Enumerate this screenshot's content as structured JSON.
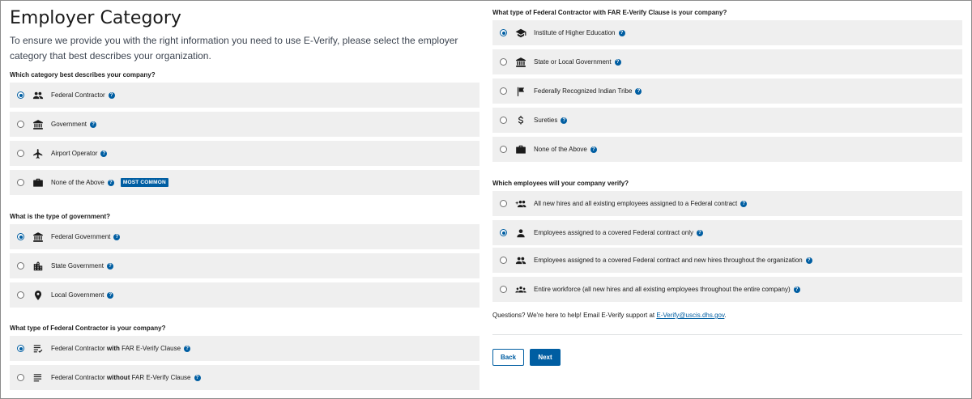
{
  "page": {
    "title": "Employer Category",
    "intro": "To ensure we provide you with the right information you need to use E-Verify, please select the employer category that best describes your organization."
  },
  "q1": {
    "question": "Which category best describes your company?",
    "options": [
      {
        "label": "Federal Contractor",
        "icon": "people-icon",
        "selected": true
      },
      {
        "label": "Government",
        "icon": "bank-icon",
        "selected": false
      },
      {
        "label": "Airport Operator",
        "icon": "airplane-icon",
        "selected": false
      },
      {
        "label": "None of the Above",
        "icon": "briefcase-icon",
        "selected": false,
        "badge": "MOST COMMON"
      }
    ]
  },
  "q2": {
    "question": "What is the type of government?",
    "options": [
      {
        "label": "Federal Government",
        "icon": "bank-icon",
        "selected": true
      },
      {
        "label": "State Government",
        "icon": "city-icon",
        "selected": false
      },
      {
        "label": "Local Government",
        "icon": "map-pin-icon",
        "selected": false
      }
    ]
  },
  "q3": {
    "question": "What type of Federal Contractor is your company?",
    "options": [
      {
        "pre": "Federal Contractor ",
        "emph": "with",
        "post": " FAR E-Verify Clause",
        "icon": "checklist-icon",
        "selected": true
      },
      {
        "pre": "Federal Contractor ",
        "emph": "without",
        "post": " FAR E-Verify Clause",
        "icon": "list-icon",
        "selected": false
      }
    ]
  },
  "q4": {
    "question": "What type of Federal Contractor with FAR E-Verify Clause is your company?",
    "options": [
      {
        "label": "Institute of Higher Education",
        "icon": "graduation-cap-icon",
        "selected": true
      },
      {
        "label": "State or Local Government",
        "icon": "bank-icon",
        "selected": false
      },
      {
        "label": "Federally Recognized Indian Tribe",
        "icon": "flag-icon",
        "selected": false
      },
      {
        "label": "Sureties",
        "icon": "dollar-icon",
        "selected": false
      },
      {
        "label": "None of the Above",
        "icon": "briefcase-icon",
        "selected": false
      }
    ]
  },
  "q5": {
    "question": "Which employees will your company verify?",
    "options": [
      {
        "label": "All new hires and all existing employees assigned to a Federal contract",
        "icon": "group-add-icon",
        "selected": false
      },
      {
        "label": "Employees assigned to a covered Federal contract only",
        "icon": "person-icon",
        "selected": true
      },
      {
        "label": "Employees assigned to a covered Federal contract and new hires throughout the organization",
        "icon": "people-icon",
        "selected": false
      },
      {
        "label": "Entire workforce (all new hires and all existing employees throughout the entire company)",
        "icon": "groups-icon",
        "selected": false
      }
    ]
  },
  "contact": {
    "text": "Questions?  We're here to help! Email E-Verify support at ",
    "email": "E-Verify@uscis.dhs.gov",
    "suffix": "."
  },
  "help_glyph": "?",
  "buttons": {
    "back": "Back",
    "next": "Next"
  },
  "colors": {
    "accent": "#005ea2",
    "option_bg": "#efefef",
    "text": "#1b1b1b"
  }
}
